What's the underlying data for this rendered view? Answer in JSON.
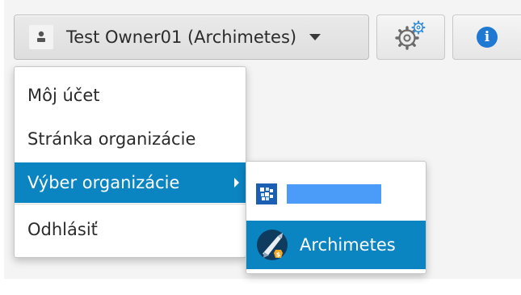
{
  "header": {
    "user_name": "Test Owner01 (Archimetes)",
    "user_icon": "user-icon",
    "settings_icon": "gear-icon",
    "info_icon": "info-icon",
    "info_glyph": "i"
  },
  "user_menu": {
    "items": [
      {
        "label": "Môj účet"
      },
      {
        "label": "Stránka organizácie"
      },
      {
        "label": "Výber organizácie",
        "has_submenu": true,
        "active": true
      },
      {
        "label": "Odhlásiť"
      }
    ]
  },
  "org_submenu": {
    "items": [
      {
        "label": "",
        "icon": "organization-icon",
        "redacted": true
      },
      {
        "label": "Archimetes",
        "icon": "archimetes-logo",
        "selected": true
      }
    ]
  },
  "colors": {
    "accent": "#0b84c2",
    "info_blue": "#1f78d1",
    "redaction_blue": "#4a9cf8"
  }
}
